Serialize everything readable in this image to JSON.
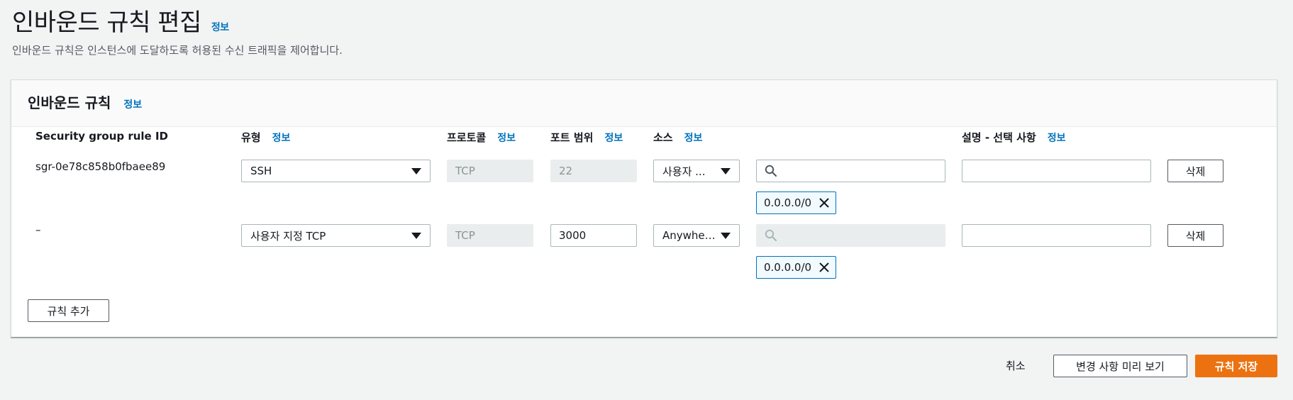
{
  "page": {
    "title": "인바운드 규칙 편집",
    "info_label": "정보",
    "description": "인바운드 규칙은 인스턴스에 도달하도록 허용된 수신 트래픽을 제어합니다."
  },
  "panel": {
    "title": "인바운드 규칙",
    "info_label": "정보"
  },
  "columns": {
    "rule_id": "Security group rule ID",
    "type": "유형",
    "protocol": "프로토콜",
    "port_range": "포트 범위",
    "source": "소스",
    "description": "설명 - 선택 사항",
    "info_label": "정보"
  },
  "rules": [
    {
      "rule_id": "sgr-0e78c858b0fbaee89",
      "type": "SSH",
      "protocol": "TCP",
      "port_range": "22",
      "source": "사용자 ...",
      "source_token": "0.0.0.0/0",
      "description": "",
      "delete_label": "삭제"
    },
    {
      "rule_id": "–",
      "type": "사용자 지정 TCP",
      "protocol": "TCP",
      "port_range": "3000",
      "source": "Anywher...",
      "source_token": "0.0.0.0/0",
      "description": "",
      "delete_label": "삭제"
    }
  ],
  "add_rule_label": "규칙 추가",
  "footer": {
    "cancel_label": "취소",
    "preview_label": "변경 사항 미리 보기",
    "save_label": "규칙 저장"
  },
  "colors": {
    "accent": "#0073bb",
    "primary_button": "#ec7211",
    "background": "#f2f3f3"
  },
  "icons": [
    "caret-down-icon",
    "search-icon",
    "close-icon"
  ]
}
